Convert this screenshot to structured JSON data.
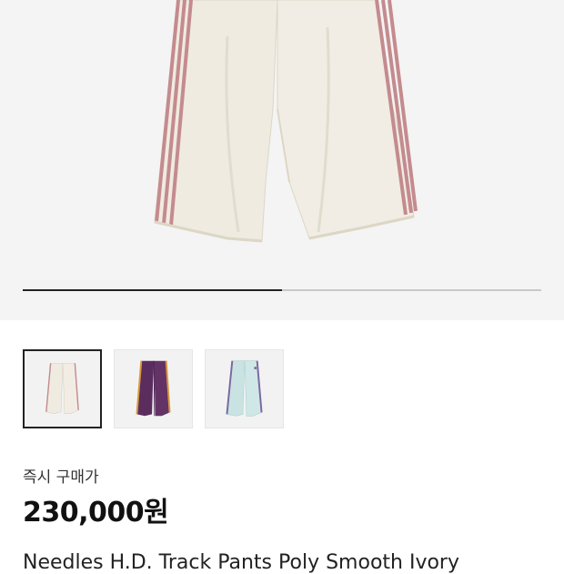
{
  "gallery": {
    "progress": 0.5,
    "thumbnails": [
      {
        "color": "cream",
        "icon": "cream-track-pants-image",
        "selected": true
      },
      {
        "color": "purple",
        "icon": "purple-track-pants-image",
        "selected": false
      },
      {
        "color": "mint",
        "icon": "mint-track-pants-image",
        "selected": false
      }
    ]
  },
  "pricing": {
    "label": "즉시 구매가",
    "price": "230,000원"
  },
  "product": {
    "name": "Needles H.D. Track Pants Poly Smooth Ivory"
  },
  "colors": {
    "hero_bg": "#f4f4f4",
    "pants_cream": "#efebe1",
    "stripe_pink": "#c48b8e",
    "pants_purple": "#5b2d5e",
    "pants_mint": "#c9e3e3"
  }
}
